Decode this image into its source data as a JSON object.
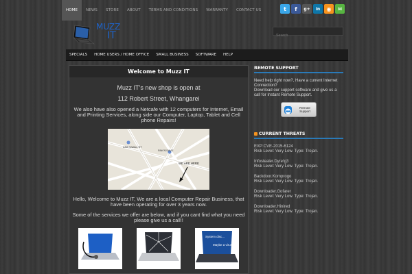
{
  "topnav": [
    {
      "label": "Home",
      "active": true
    },
    {
      "label": "News"
    },
    {
      "label": "Store"
    },
    {
      "label": "About"
    },
    {
      "label": "Terms and Conditions"
    },
    {
      "label": "Warranty"
    },
    {
      "label": "Contact Us"
    }
  ],
  "social": [
    {
      "icon": "twitter-icon",
      "glyph": "t",
      "color": "#3aa6e8"
    },
    {
      "icon": "facebook-icon",
      "glyph": "f",
      "color": "#3b5998"
    },
    {
      "icon": "google-plus-icon",
      "glyph": "g+",
      "color": "#555555"
    },
    {
      "icon": "linkedin-icon",
      "glyph": "in",
      "color": "#0e76a8"
    },
    {
      "icon": "rss-icon",
      "glyph": "◉",
      "color": "#f7931e"
    },
    {
      "icon": "email-icon",
      "glyph": "✉",
      "color": "#57b541"
    }
  ],
  "logo": {
    "line1": "MUZZ",
    "line2": "IT"
  },
  "search": {
    "placeholder": "Search"
  },
  "mainnav": [
    "Specials",
    "Home Users / Home Office",
    "Small Business",
    "Software",
    "Help"
  ],
  "content": {
    "title": "Welcome to Muzz IT",
    "shop_line": "Muzz IT’s new shop is open at",
    "address": "112 Robert Street, Whangarei",
    "also": "We also have also opened a Netcafe with 12 computers for Internet, Email and Printing Services, along side our Computer, Laptop, Tablet and Cell phone Repairs!",
    "map": {
      "label_a": "ASB Walton ST",
      "label_b": "PAK'N'SAVE",
      "label_c": "WE ARE HERE"
    },
    "hello": "Hello, Welcome to Muzz IT, We are a local Computer Repair Business, that have been operating for over 3 years now.",
    "services": "Some of the services we offer are below, and if you cant find what you need please give us a call!!",
    "thumb3_text": [
      "System disc...",
      "Maybe a virus"
    ]
  },
  "sidebar": {
    "remote_title": "REMOTE SUPPORT",
    "remote_text": "Need help right now?, Have a current Internet Connection?\nDownload our support software and give us a call for Instant Remote Support.",
    "remote_btn": "Remote Support",
    "threats_title": "CURRENT THREATS",
    "threats": [
      {
        "name": "EXP:CVE-2015-6124",
        "risk": "Risk Level: Very Low. Type: Trojan."
      },
      {
        "name": "Infostealer.Dyre!g3",
        "risk": "Risk Level: Very Low. Type: Trojan."
      },
      {
        "name": "Backdoor.Komprogo",
        "risk": "Risk Level: Very Low. Type: Trojan."
      },
      {
        "name": "Downloader.Gofarer",
        "risk": "Risk Level: Very Low. Type: Trojan."
      },
      {
        "name": "Downloader.Hinired",
        "risk": "Risk Level: Very Low. Type: Trojan."
      }
    ]
  }
}
